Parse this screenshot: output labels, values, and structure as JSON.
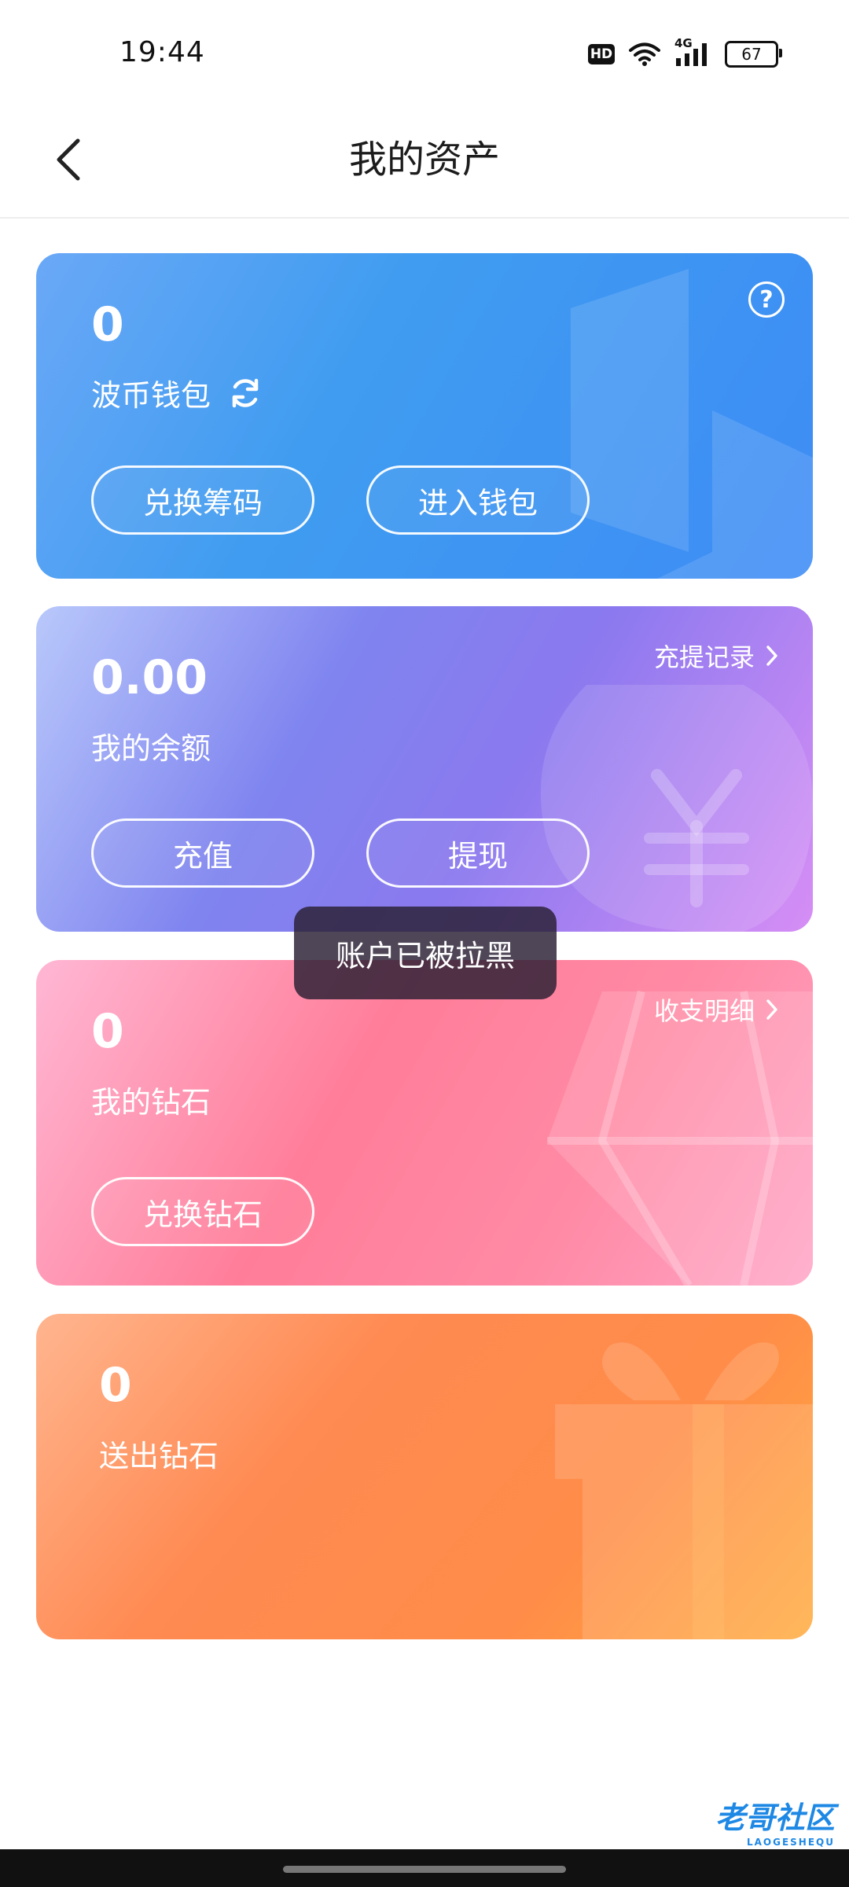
{
  "status": {
    "time": "19:44",
    "hd": "HD",
    "network": "4G",
    "battery": "67"
  },
  "header": {
    "title": "我的资产"
  },
  "wallet_card": {
    "amount": "0",
    "label": "波币钱包",
    "btn_exchange": "兑换筹码",
    "btn_enter": "进入钱包",
    "help": "?"
  },
  "balance_card": {
    "amount": "0.00",
    "label": "我的余额",
    "link": "充提记录",
    "btn_recharge": "充值",
    "btn_withdraw": "提现"
  },
  "diamond_card": {
    "amount": "0",
    "label": "我的钻石",
    "link": "收支明细",
    "btn_exchange": "兑换钻石"
  },
  "gift_card": {
    "amount": "0",
    "label": "送出钻石"
  },
  "toast": {
    "text": "账户已被拉黑"
  },
  "watermark": {
    "text": "老哥社区",
    "sub": "LAOGESHEQU"
  },
  "icons": [
    "back-icon",
    "refresh-icon",
    "help-icon",
    "chevron-right-icon",
    "wifi-icon",
    "signal-icon",
    "battery-icon"
  ]
}
